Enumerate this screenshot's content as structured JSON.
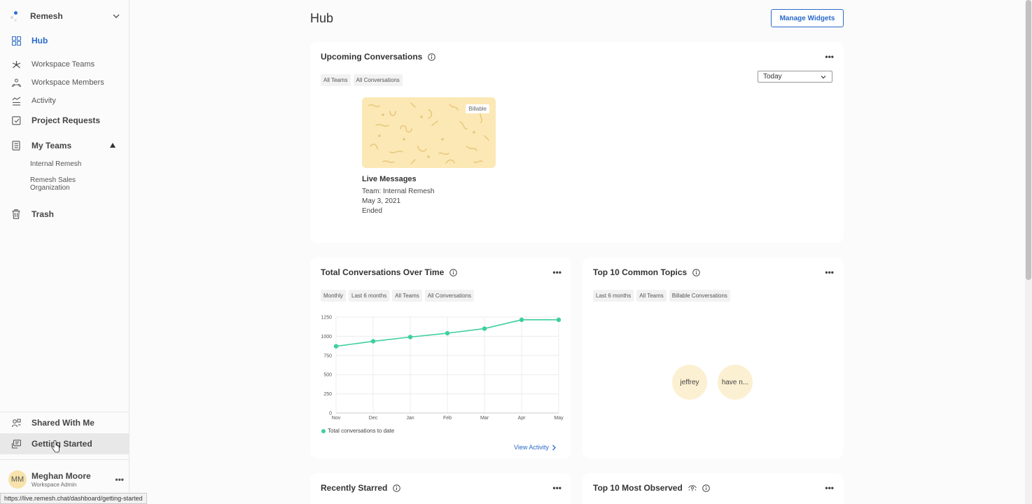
{
  "sidebar": {
    "org_name": "Remesh",
    "nav": {
      "hub": "Hub",
      "workspace_teams": "Workspace Teams",
      "workspace_members": "Workspace Members",
      "activity": "Activity",
      "project_requests": "Project Requests",
      "my_teams": "My Teams",
      "trash": "Trash",
      "shared_with_me": "Shared With Me",
      "getting_started": "Getting Started"
    },
    "teams": [
      "Internal Remesh",
      "Remesh Sales Organization"
    ],
    "user": {
      "initials": "MM",
      "name": "Meghan Moore",
      "role": "Workspace Admin"
    }
  },
  "status_url": "https://live.remesh.chat/dashboard/getting-started",
  "header": {
    "title": "Hub",
    "manage_widgets": "Manage Widgets"
  },
  "upcoming": {
    "title": "Upcoming Conversations",
    "chips": [
      "All Teams",
      "All Conversations"
    ],
    "range_select": "Today",
    "conversation": {
      "badge": "Billable",
      "title": "Live Messages",
      "team": "Team: Internal Remesh",
      "date": "May 3, 2021",
      "status": "Ended"
    }
  },
  "total_conversations": {
    "title": "Total Conversations Over Time",
    "chips": [
      "Monthly",
      "Last 6 months",
      "All Teams",
      "All Conversations"
    ],
    "view_link": "View Activity"
  },
  "top_topics": {
    "title": "Top 10 Common Topics",
    "chips": [
      "Last 6 months",
      "All Teams",
      "Billable Conversations"
    ],
    "topics": [
      "jeffrey",
      "have n..."
    ]
  },
  "recently_starred": {
    "title": "Recently Starred"
  },
  "most_observed": {
    "title": "Top 10 Most Observed"
  },
  "colors": {
    "accent": "#2a6ac9",
    "line": "#3ecfa0",
    "bubble": "#fcf0d2"
  },
  "chart_data": {
    "type": "line",
    "categories": [
      "Nov",
      "Dec",
      "Jan",
      "Feb",
      "Mar",
      "Apr",
      "May"
    ],
    "series": [
      {
        "name": "Total conversations to date",
        "values": [
          870,
          935,
          990,
          1040,
          1100,
          1215,
          1215
        ]
      }
    ],
    "yticks": [
      0,
      250,
      500,
      750,
      1000,
      1250
    ],
    "ylim": [
      0,
      1250
    ],
    "grid": true
  }
}
